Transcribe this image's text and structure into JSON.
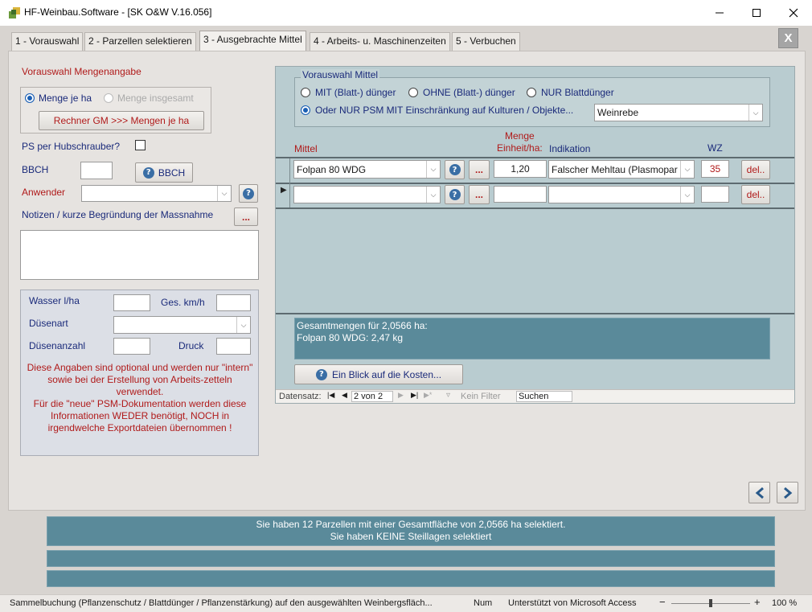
{
  "window": {
    "title": "HF-Weinbau.Software - [SK O&W V.16.056]",
    "icon": "app-logo-icon"
  },
  "tabs": [
    {
      "label": "1 - Vorauswahl"
    },
    {
      "label": "2 - Parzellen selektieren"
    },
    {
      "label": "3 - Ausgebrachte Mittel"
    },
    {
      "label": "4 - Arbeits- u. Maschinenzeiten"
    },
    {
      "label": "5 - Verbuchen"
    }
  ],
  "close_tab_label": "X",
  "left": {
    "vorauswahl_heading": "Vorauswahl Mengenangabe",
    "radio_ha": "Menge je ha",
    "radio_total": "Menge insgesamt",
    "rechner_button": "Rechner GM >>> Mengen je ha",
    "ps_label": "PS per Hubschrauber?",
    "bbch_label": "BBCH",
    "bbch_button": "BBCH",
    "anwender_label": "Anwender",
    "notes_label": "Notizen / kurze Begründung der Massnahme",
    "ellipsis": "...",
    "wasser_label": "Wasser l/ha",
    "ges_label": "Ges. km/h",
    "duesenart_label": "Düsenart",
    "duesenanzahl_label": "Düsenanzahl",
    "druck_label": "Druck",
    "info_text": "Diese Angaben sind optional und werden nur \"intern\" sowie bei der Erstellung von Arbeits-zetteln verwendet.\nFür die \"neue\" PSM-Dokumentation werden diese Informationen WEDER benötigt, NOCH in irgendwelche Exportdateien übernommen !"
  },
  "right": {
    "group_title": "Vorauswahl Mittel",
    "opt_mit": "MIT (Blatt-) dünger",
    "opt_ohne": "OHNE (Blatt-) dünger",
    "opt_nur": "NUR Blattdünger",
    "opt_psm": "Oder NUR PSM MIT Einschränkung auf Kulturen / Objekte...",
    "kultur_value": "Weinrebe",
    "col_mittel": "Mittel",
    "col_menge_1": "Menge",
    "col_menge_2": "Einheit/ha:",
    "col_indikation": "Indikation",
    "col_wz": "WZ",
    "rows": [
      {
        "mittel": "Folpan 80 WDG",
        "menge": "1,20",
        "indikation": "Falscher Mehltau (Plasmopar",
        "wz": "35",
        "del": "del.."
      },
      {
        "mittel": "",
        "menge": "",
        "indikation": "",
        "wz": "",
        "del": "del.."
      }
    ],
    "summary_line1": "Gesamtmengen für 2,0566 ha:",
    "summary_line2": "Folpan 80 WDG: 2,47 kg",
    "costs_button": "Ein Blick auf die Kosten...",
    "nav_label": "Datensatz:",
    "nav_value": "2 von 2",
    "filter_label": "Kein Filter",
    "search_value": "Suchen"
  },
  "info_bar": {
    "line1": "Sie haben 12 Parzellen mit einer Gesamtfläche von 2,0566 ha selektiert.",
    "line2": "Sie haben KEINE Steillagen selektiert"
  },
  "statusbar": {
    "message": "Sammelbuchung (Pflanzenschutz / Blattdünger / Pflanzenstärkung) auf den ausgewählten Weinbergsfläch...",
    "num": "Num",
    "support": "Unterstützt von Microsoft Access",
    "zoom": "100 %",
    "zoom_level_percent": 100
  },
  "colors": {
    "accent": "#1a5fb4",
    "label_red": "#b01a1a",
    "label_navy": "#1a2a7a",
    "grid_bg": "#b9ccd0",
    "info_bar": "#5a8a9a"
  }
}
